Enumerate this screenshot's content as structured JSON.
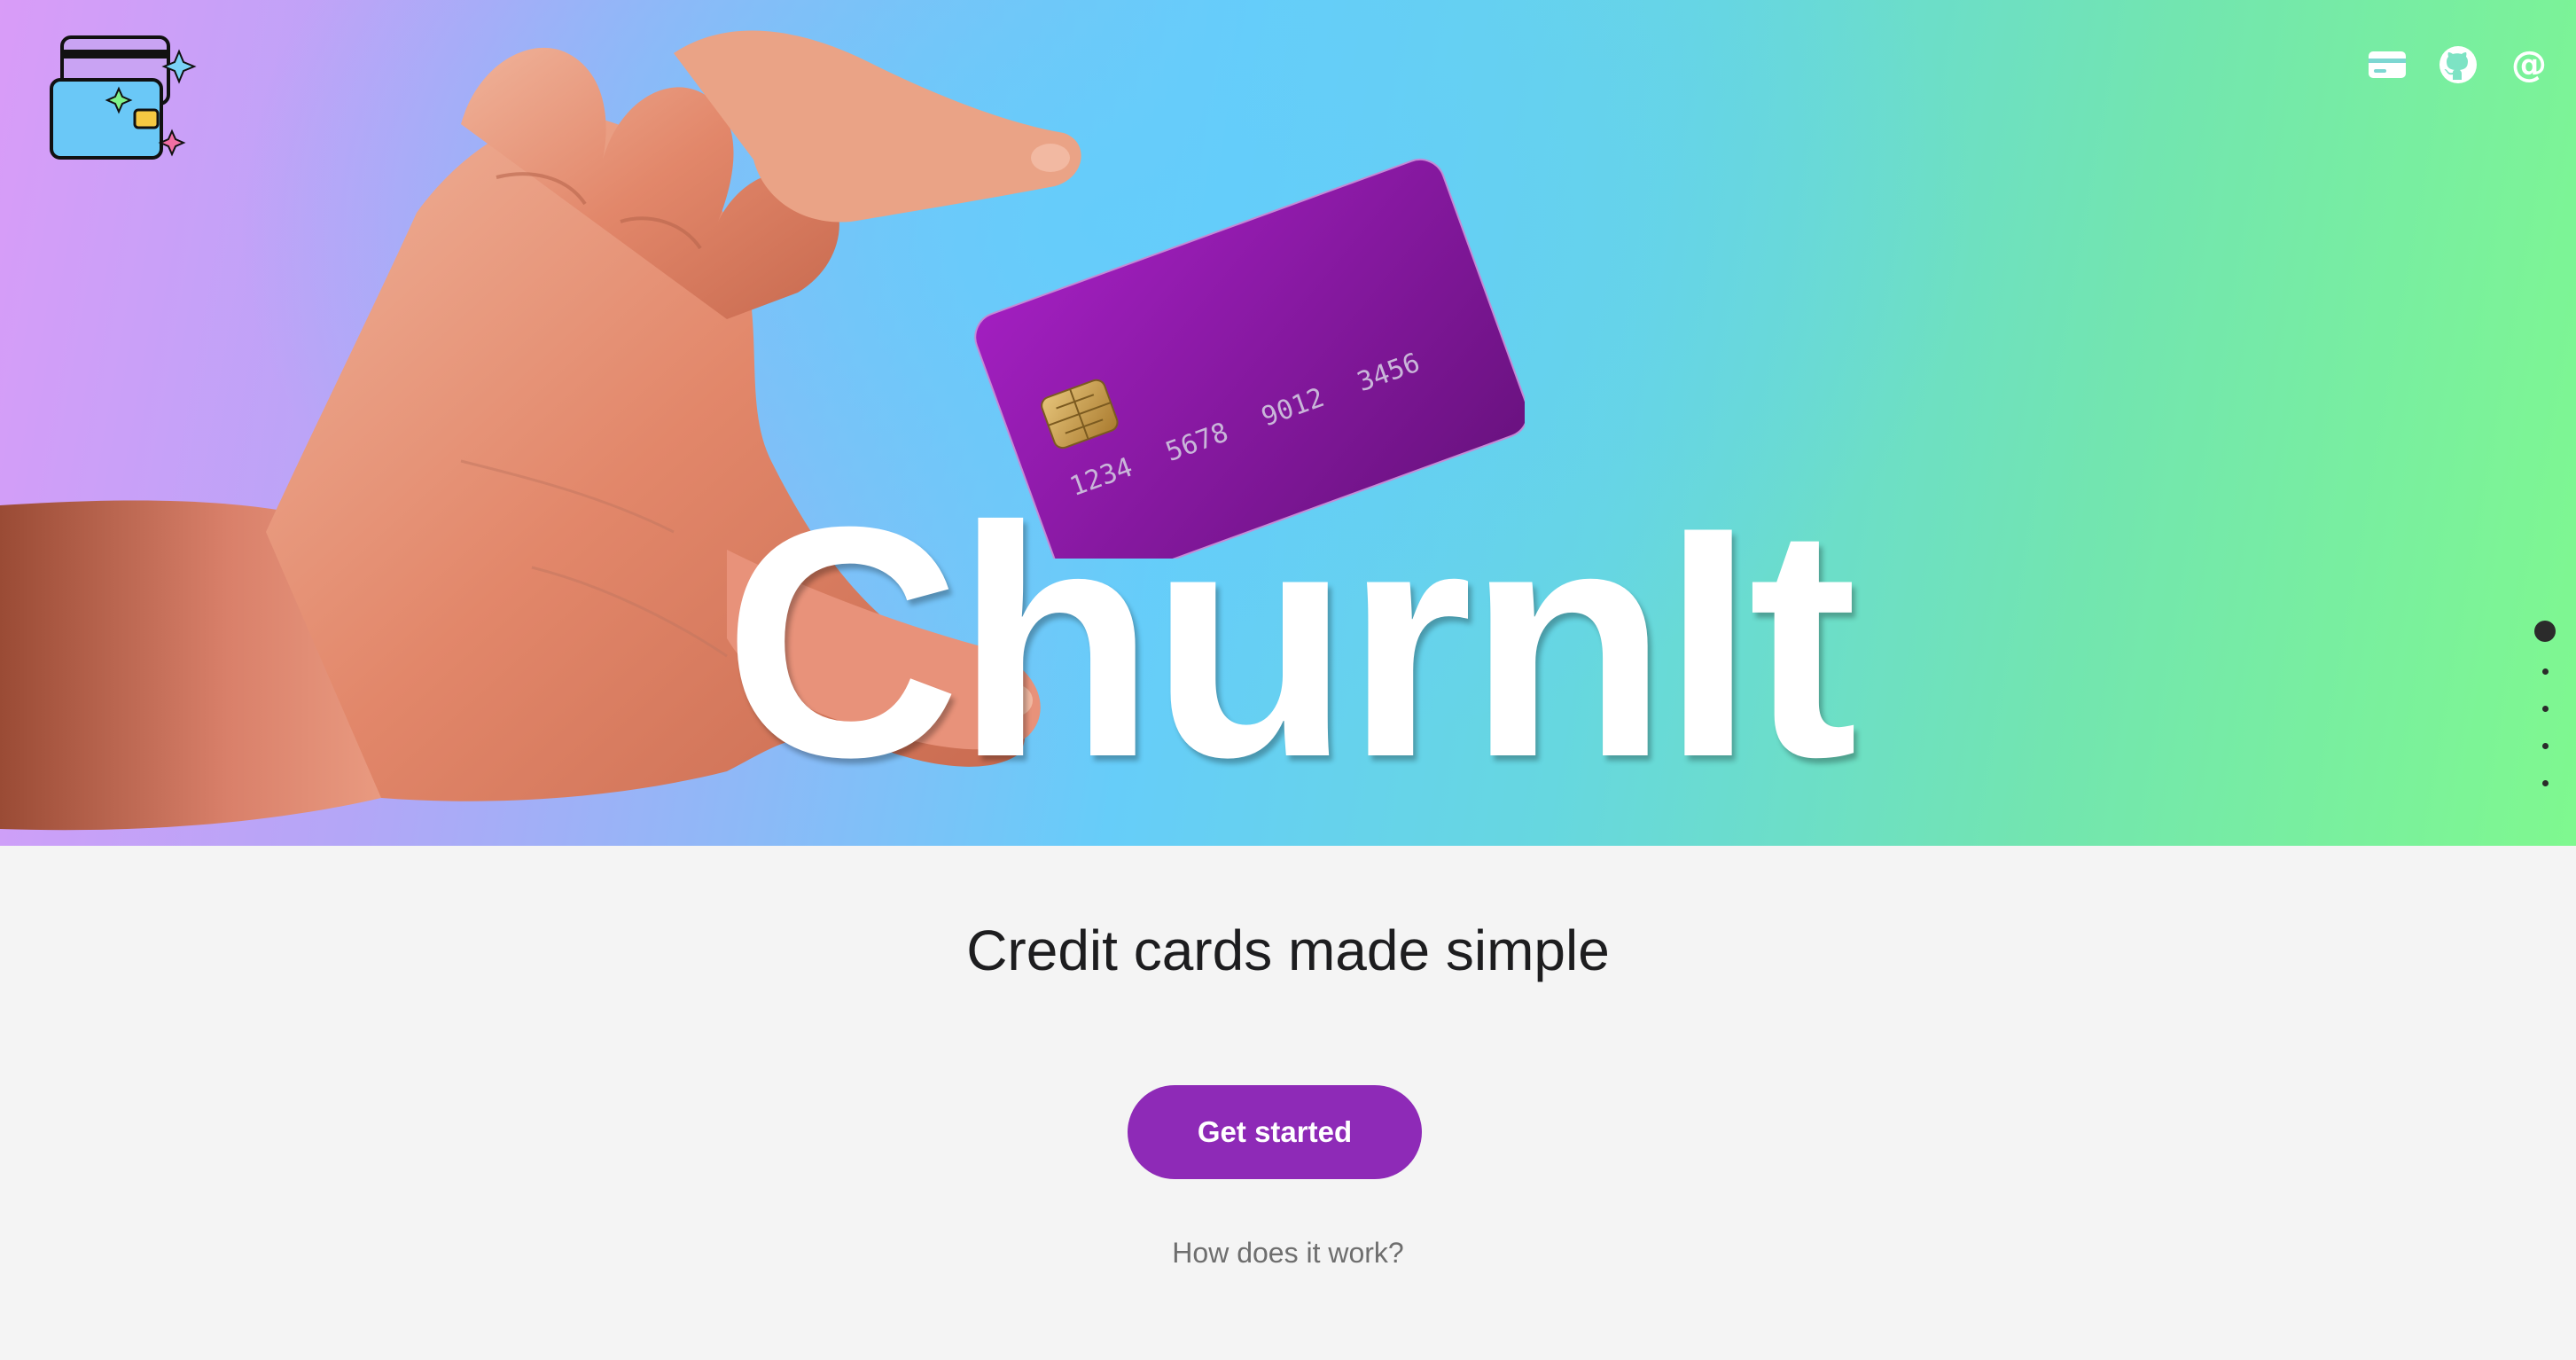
{
  "brand": {
    "name": "ChurnIt",
    "logo_icon": "wallet-icon"
  },
  "nav": {
    "icons": [
      "credit-card-icon",
      "github-icon",
      "at-icon"
    ]
  },
  "hero_card": {
    "numbers": [
      "1234",
      "5678",
      "9012",
      "3456"
    ],
    "color": "#8e1fb0"
  },
  "main": {
    "tagline": "Credit cards made simple",
    "cta_label": "Get started",
    "secondary_link": "How does it work?"
  },
  "pagination": {
    "count": 5,
    "active_index": 0
  },
  "colors": {
    "accent": "#8e2ab7",
    "gradient_left": "#d99cf8",
    "gradient_mid": "#66cdf9",
    "gradient_right": "#7ff88f",
    "background": "#f4f4f4"
  }
}
